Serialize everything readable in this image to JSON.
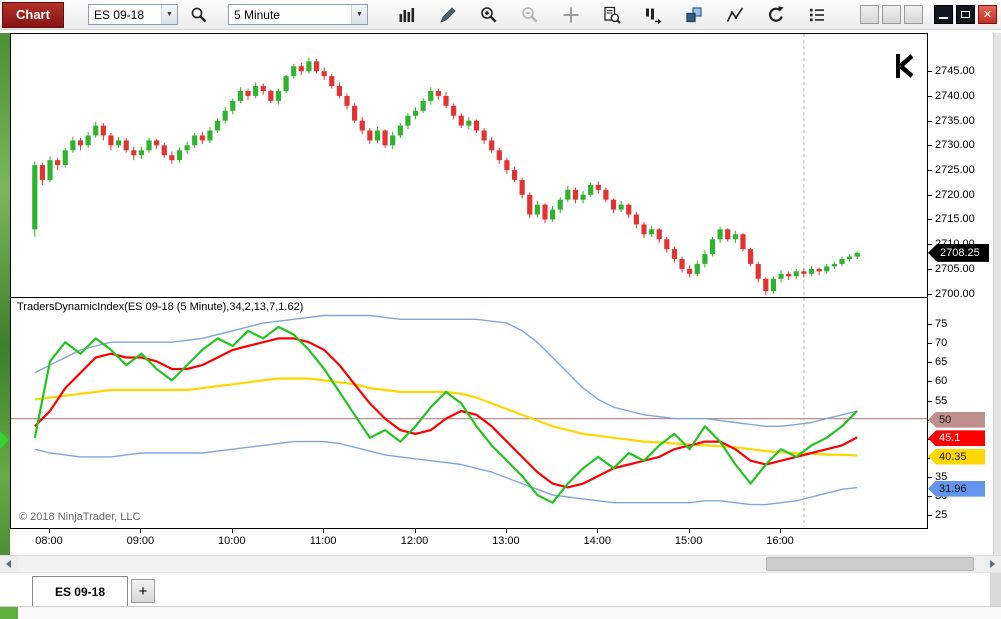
{
  "titlebar": {
    "app_label": "Chart",
    "instrument_value": "ES 09-18",
    "interval_value": "5 Minute",
    "icon_names": [
      "search",
      "chart-style",
      "drawing-tools",
      "zoom-in",
      "zoom-out",
      "crosshair",
      "data-box",
      "indicator-panel",
      "tile-windows",
      "trend-line",
      "reload",
      "properties"
    ],
    "window_controls": {
      "close_glyph": "✕"
    }
  },
  "chart": {
    "price_axis": {
      "ticks": [
        "2745.00",
        "2740.00",
        "2735.00",
        "2730.00",
        "2725.00",
        "2720.00",
        "2715.00",
        "2710.00",
        "2705.00",
        "2700.00"
      ],
      "last_price_label": "2708.25"
    },
    "indicator": {
      "label": "TradersDynamicIndex(ES 09-18 (5 Minute),34,2,13,7,1.62)",
      "axis_ticks": [
        "75",
        "70",
        "65",
        "60",
        "55",
        "50",
        "45",
        "40",
        "35",
        "30",
        "25"
      ],
      "badges": [
        {
          "text": "50",
          "value": 50,
          "bg": "#bd8e8e",
          "fg": "#1a1a1a"
        },
        {
          "text": "45.1",
          "value": 45.1,
          "bg": "#fe0000",
          "fg": "#ffffff"
        },
        {
          "text": "40.35",
          "value": 40.35,
          "bg": "#ffd700",
          "fg": "#1a1a1a"
        },
        {
          "text": "31.96",
          "value": 31.96,
          "bg": "#6495ed",
          "fg": "#101010"
        }
      ]
    },
    "copyright": "© 2018 NinjaTrader, LLC",
    "time_ticks": [
      {
        "label": "08:00",
        "bar": 2
      },
      {
        "label": "09:00",
        "bar": 14
      },
      {
        "label": "10:00",
        "bar": 26
      },
      {
        "label": "11:00",
        "bar": 38
      },
      {
        "label": "12:00",
        "bar": 50
      },
      {
        "label": "13:00",
        "bar": 62
      },
      {
        "label": "14:00",
        "bar": 74
      },
      {
        "label": "15:00",
        "bar": 86
      },
      {
        "label": "16:00",
        "bar": 98
      }
    ]
  },
  "tabs": {
    "active_label": "ES 09-18",
    "add_label": "+"
  },
  "chart_data": [
    {
      "type": "candlestick",
      "title": "ES 09-18 5 Minute",
      "ylim": [
        2698.5,
        2749.5
      ],
      "last_price": 2708.25,
      "up_color": "#2fb32f",
      "down_color": "#e23232",
      "session_break_bar": 101,
      "start_time": "07:50",
      "bar_minutes": 5,
      "candles": [
        [
          2713,
          2726.75,
          2711.5,
          2726
        ],
        [
          2726,
          2726.5,
          2722,
          2723
        ],
        [
          2723,
          2727.75,
          2722.5,
          2727
        ],
        [
          2727,
          2727.5,
          2725,
          2726
        ],
        [
          2726,
          2729.5,
          2725.5,
          2729
        ],
        [
          2729,
          2731.75,
          2728.5,
          2731
        ],
        [
          2731,
          2731.5,
          2729,
          2730
        ],
        [
          2730,
          2732.75,
          2729.5,
          2732
        ],
        [
          2732,
          2734.75,
          2731.5,
          2734
        ],
        [
          2734,
          2734.5,
          2731,
          2732
        ],
        [
          2732,
          2732.5,
          2729,
          2730
        ],
        [
          2730,
          2731.75,
          2729.5,
          2731
        ],
        [
          2731,
          2731.5,
          2728.5,
          2729
        ],
        [
          2729,
          2729.75,
          2727,
          2728
        ],
        [
          2728,
          2729.75,
          2727.25,
          2729
        ],
        [
          2729,
          2731.5,
          2728.5,
          2731
        ],
        [
          2731,
          2731.25,
          2729.25,
          2730
        ],
        [
          2730,
          2730.5,
          2727.5,
          2728
        ],
        [
          2728,
          2728.75,
          2726.25,
          2727
        ],
        [
          2727,
          2729.5,
          2726.5,
          2729
        ],
        [
          2729,
          2730.75,
          2728.25,
          2730
        ],
        [
          2730,
          2732.5,
          2729.5,
          2732
        ],
        [
          2732,
          2732.75,
          2730.25,
          2731
        ],
        [
          2731,
          2733.75,
          2730.5,
          2733
        ],
        [
          2733,
          2735.5,
          2732.5,
          2735
        ],
        [
          2735,
          2737.75,
          2734.5,
          2737
        ],
        [
          2737,
          2739.5,
          2736.25,
          2739
        ],
        [
          2739,
          2741.75,
          2738.5,
          2741
        ],
        [
          2741,
          2741.5,
          2739.25,
          2740
        ],
        [
          2740,
          2742.75,
          2739.5,
          2742
        ],
        [
          2742,
          2742.5,
          2740.25,
          2741
        ],
        [
          2741,
          2741.25,
          2738.5,
          2739
        ],
        [
          2739,
          2741.5,
          2738.25,
          2741
        ],
        [
          2741,
          2744.25,
          2740.5,
          2744
        ],
        [
          2744,
          2746.5,
          2743.5,
          2746
        ],
        [
          2746,
          2746.75,
          2744.25,
          2745
        ],
        [
          2745,
          2747.75,
          2744.5,
          2747
        ],
        [
          2747,
          2747.5,
          2744.5,
          2745
        ],
        [
          2745,
          2745.75,
          2743.25,
          2744
        ],
        [
          2744,
          2744.5,
          2741.5,
          2742
        ],
        [
          2742,
          2742.75,
          2739.5,
          2740
        ],
        [
          2740,
          2740.5,
          2737.25,
          2738
        ],
        [
          2738,
          2738.5,
          2734.5,
          2735
        ],
        [
          2735,
          2735.75,
          2732.25,
          2733
        ],
        [
          2733,
          2733.5,
          2730.25,
          2731
        ],
        [
          2731,
          2733.75,
          2730.5,
          2733
        ],
        [
          2733,
          2733.25,
          2729.5,
          2730
        ],
        [
          2730,
          2732.75,
          2729.25,
          2732
        ],
        [
          2732,
          2734.5,
          2731.5,
          2734
        ],
        [
          2734,
          2736.5,
          2733.25,
          2736
        ],
        [
          2736,
          2737.75,
          2735.25,
          2737
        ],
        [
          2737,
          2739.5,
          2736.5,
          2739
        ],
        [
          2739,
          2741.75,
          2738.25,
          2741
        ],
        [
          2741,
          2741.5,
          2739.25,
          2740
        ],
        [
          2740,
          2740.75,
          2737.5,
          2738
        ],
        [
          2738,
          2738.5,
          2735.25,
          2736
        ],
        [
          2736,
          2736.5,
          2733.5,
          2734
        ],
        [
          2734,
          2735.75,
          2733.25,
          2735
        ],
        [
          2735,
          2735.25,
          2732.5,
          2733
        ],
        [
          2733,
          2733.5,
          2730.25,
          2731
        ],
        [
          2731,
          2731.75,
          2728.5,
          2729
        ],
        [
          2729,
          2729.5,
          2726.25,
          2727
        ],
        [
          2727,
          2727.5,
          2724.25,
          2725
        ],
        [
          2725,
          2725.75,
          2722.5,
          2723
        ],
        [
          2723,
          2723.5,
          2719.25,
          2720
        ],
        [
          2720,
          2720.5,
          2715.25,
          2716
        ],
        [
          2716,
          2718.75,
          2715.5,
          2718
        ],
        [
          2718,
          2718.25,
          2714.25,
          2715
        ],
        [
          2715,
          2717.75,
          2714.5,
          2717
        ],
        [
          2717,
          2719.5,
          2716.25,
          2719
        ],
        [
          2719,
          2721.75,
          2718.5,
          2721
        ],
        [
          2721,
          2721.5,
          2718.25,
          2719
        ],
        [
          2719,
          2720.75,
          2718.25,
          2720
        ],
        [
          2720,
          2722.5,
          2719.5,
          2722
        ],
        [
          2722,
          2722.75,
          2720.25,
          2721
        ],
        [
          2721,
          2721.5,
          2718.5,
          2719
        ],
        [
          2719,
          2719.25,
          2716.25,
          2717
        ],
        [
          2717,
          2718.75,
          2716.5,
          2718
        ],
        [
          2718,
          2718.25,
          2715.25,
          2716
        ],
        [
          2716,
          2716.5,
          2713.25,
          2714
        ],
        [
          2714,
          2714.5,
          2711.25,
          2712
        ],
        [
          2712,
          2713.75,
          2711.5,
          2713
        ],
        [
          2713,
          2713.25,
          2710.25,
          2711
        ],
        [
          2711,
          2711.5,
          2708.25,
          2709
        ],
        [
          2709,
          2709.5,
          2706.25,
          2707
        ],
        [
          2707,
          2707.5,
          2704.25,
          2705
        ],
        [
          2705,
          2705.75,
          2703.25,
          2704
        ],
        [
          2704,
          2706.75,
          2703.5,
          2706
        ],
        [
          2706,
          2708.75,
          2705.25,
          2708
        ],
        [
          2708,
          2711.5,
          2707.5,
          2711
        ],
        [
          2711,
          2713.5,
          2710.25,
          2713
        ],
        [
          2713,
          2713.25,
          2710.5,
          2711
        ],
        [
          2711,
          2712.75,
          2710.25,
          2712
        ],
        [
          2712,
          2712.25,
          2708.5,
          2709
        ],
        [
          2709,
          2709.25,
          2705.5,
          2706
        ],
        [
          2706,
          2706.5,
          2702.25,
          2703
        ],
        [
          2703,
          2703.25,
          2699.75,
          2700.5
        ],
        [
          2700.5,
          2703.5,
          2700,
          2703
        ],
        [
          2703,
          2704.75,
          2702.25,
          2704
        ],
        [
          2704,
          2704.5,
          2702.75,
          2703.5
        ],
        [
          2703.5,
          2705,
          2703,
          2704.5
        ],
        [
          2704.5,
          2705,
          2703.25,
          2704
        ],
        [
          2704,
          2705.5,
          2703.5,
          2705
        ],
        [
          2705,
          2705.25,
          2703.75,
          2704.5
        ],
        [
          2704.5,
          2706,
          2704,
          2705.5
        ],
        [
          2705.5,
          2706.5,
          2705,
          2706
        ],
        [
          2706,
          2707.5,
          2705.5,
          2707
        ],
        [
          2707,
          2708,
          2706.5,
          2707.5
        ],
        [
          2707.5,
          2708.5,
          2707,
          2708.25
        ]
      ]
    },
    {
      "type": "line",
      "title": "TradersDynamicIndex(ES 09-18 (5 Minute),34,2,13,7,1.62)",
      "ylim": [
        24,
        80
      ],
      "hline": {
        "value": 50,
        "color": "#bd8e8e"
      },
      "bar_step": 2,
      "series": [
        {
          "name": "upper-volatility-band",
          "color": "#7da7d9",
          "width": 1.4,
          "values": [
            62,
            64,
            66,
            68,
            69,
            70,
            70,
            70,
            70,
            70,
            70.5,
            71,
            72,
            73,
            74,
            75,
            75.5,
            76,
            76.5,
            77,
            77,
            77,
            77,
            76.5,
            76,
            76,
            76,
            76,
            76,
            76,
            75.5,
            75,
            73,
            70,
            66,
            62,
            58,
            55,
            53,
            52,
            51,
            50.5,
            50,
            50,
            50,
            49.5,
            49,
            48.5,
            48,
            48,
            48.5,
            49,
            50,
            51,
            52
          ]
        },
        {
          "name": "lower-volatility-band",
          "color": "#7da7d9",
          "width": 1.4,
          "values": [
            42,
            41,
            40.5,
            40,
            40,
            40,
            40.5,
            41,
            41,
            41,
            41,
            41,
            41.5,
            42,
            42.5,
            43,
            43.5,
            44,
            44,
            44,
            43.5,
            42.5,
            41.5,
            40.5,
            40,
            39.5,
            39,
            38.5,
            38,
            37,
            36,
            34.5,
            33,
            31.5,
            30,
            29.5,
            29,
            28.5,
            28,
            28,
            28,
            28,
            28,
            28,
            28.5,
            28.5,
            28,
            27.5,
            27.5,
            28,
            28.5,
            29.5,
            30.5,
            31.5,
            31.96
          ]
        },
        {
          "name": "market-base-line",
          "color": "#ffd700",
          "width": 2.2,
          "values": [
            55,
            55.5,
            56,
            56.5,
            57,
            57.5,
            57.5,
            57.5,
            57.5,
            57.5,
            57.5,
            58,
            58.5,
            59,
            59.5,
            60,
            60.5,
            60.5,
            60.5,
            60,
            59.5,
            59,
            58,
            57.5,
            57,
            57,
            57,
            57,
            56.5,
            55.5,
            54,
            52.5,
            51,
            49.5,
            48,
            47,
            46,
            45.5,
            45,
            44.5,
            44,
            43.8,
            43.5,
            43.2,
            43,
            42.8,
            42.5,
            42,
            41.5,
            41.2,
            41,
            40.8,
            40.6,
            40.5,
            40.35
          ]
        },
        {
          "name": "rsi-signal-line",
          "color": "#fe0000",
          "width": 2.2,
          "values": [
            48,
            52,
            58,
            62,
            66,
            67,
            66,
            66,
            65,
            63,
            63,
            64,
            66,
            68,
            69,
            70,
            71,
            71,
            70,
            68,
            64,
            59,
            54,
            50,
            47,
            46,
            47,
            50,
            52,
            51,
            48,
            44,
            40,
            36,
            33,
            32,
            33,
            35,
            37,
            38,
            39,
            40,
            42,
            43,
            44,
            44,
            42,
            39,
            38,
            39,
            40,
            41,
            42,
            43,
            45.1
          ]
        },
        {
          "name": "rsi-line",
          "color": "#21c421",
          "width": 2.2,
          "values": [
            45,
            65,
            70,
            67,
            71,
            68,
            64,
            67,
            63,
            60,
            64,
            68,
            71,
            69,
            73,
            71,
            74,
            72,
            68,
            63,
            57,
            51,
            45,
            47,
            44,
            48,
            53,
            57,
            54,
            48,
            43,
            39,
            35,
            30,
            28,
            33,
            37,
            40,
            37,
            41,
            39,
            43,
            46,
            42,
            48,
            44,
            38,
            33,
            38,
            42,
            40,
            43,
            45,
            48,
            52
          ]
        }
      ]
    }
  ]
}
